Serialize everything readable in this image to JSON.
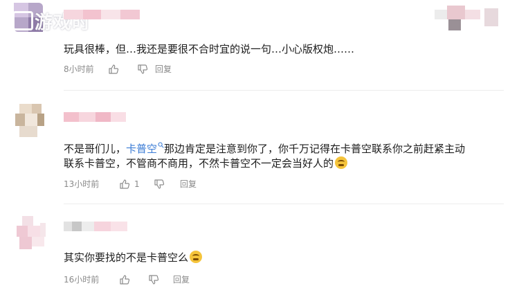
{
  "watermark": {
    "text": "游戏时"
  },
  "comments": [
    {
      "text": "玩具很棒，但…我还是要很不合时宜的说一句…小心版权炮……",
      "time": "8小时前",
      "like_count": "",
      "reply_label": "回复"
    },
    {
      "text_before": "不是哥们儿，",
      "mention": "卡普空",
      "text_after": "那边肯定是注意到你了，你千万记得在卡普空联系你之前赶紧主动",
      "text_line2": "联系卡普空，不管商不商用，不然卡普空不一定会当好人的",
      "time": "13小时前",
      "like_count": "1",
      "reply_label": "回复"
    },
    {
      "text": "其实你要找的不是卡普空么",
      "time": "16小时前",
      "like_count": "",
      "reply_label": "回复"
    }
  ],
  "colors": {
    "mention": "#3a7bd5",
    "meta": "#8a8a8a",
    "divider": "#ececec"
  }
}
